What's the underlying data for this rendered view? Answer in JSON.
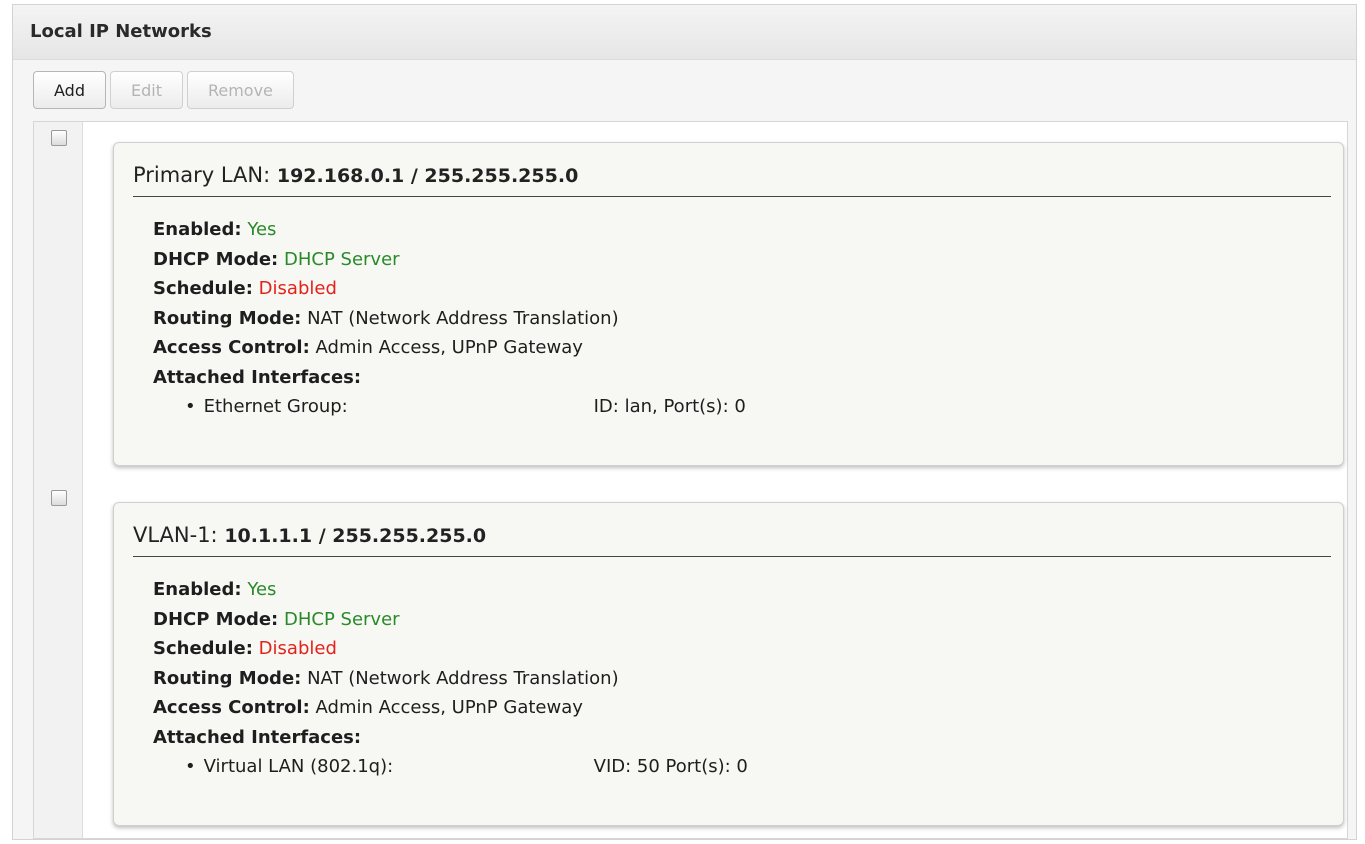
{
  "panel": {
    "title": "Local IP Networks"
  },
  "toolbar": {
    "add": "Add",
    "edit": "Edit",
    "remove": "Remove"
  },
  "networks": [
    {
      "name": "Primary LAN:",
      "address": "192.168.0.1 / 255.255.255.0",
      "enabled_label": "Enabled:",
      "enabled": "Yes",
      "dhcp_label": "DHCP Mode:",
      "dhcp": "DHCP Server",
      "schedule_label": "Schedule:",
      "schedule": "Disabled",
      "routing_label": "Routing Mode:",
      "routing": "NAT (Network Address Translation)",
      "access_label": "Access Control:",
      "access": "Admin Access, UPnP Gateway",
      "attached_label": "Attached Interfaces:",
      "interface_name": "Ethernet Group:",
      "interface_detail": "ID: lan, Port(s): 0"
    },
    {
      "name": "VLAN-1:",
      "address": "10.1.1.1 / 255.255.255.0",
      "enabled_label": "Enabled:",
      "enabled": "Yes",
      "dhcp_label": "DHCP Mode:",
      "dhcp": "DHCP Server",
      "schedule_label": "Schedule:",
      "schedule": "Disabled",
      "routing_label": "Routing Mode:",
      "routing": "NAT (Network Address Translation)",
      "access_label": "Access Control:",
      "access": "Admin Access, UPnP Gateway",
      "attached_label": "Attached Interfaces:",
      "interface_name": "Virtual LAN (802.1q):",
      "interface_detail": "VID: 50 Port(s): 0"
    }
  ],
  "colors": {
    "positive": "#2a8a2a",
    "negative": "#e2231a"
  }
}
